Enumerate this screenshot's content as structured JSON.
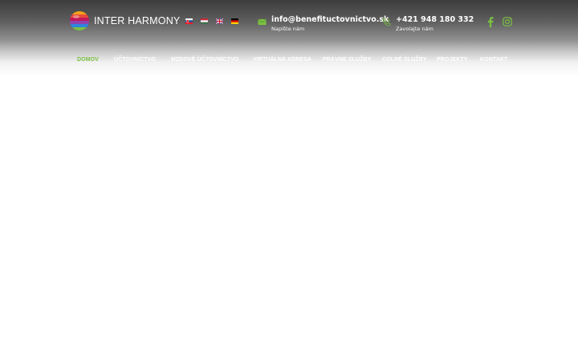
{
  "brand": {
    "name": "INTER HARMONY",
    "logo_icon": "striped-sphere-logo"
  },
  "languages": [
    {
      "code": "sk",
      "icon": "slovak-flag"
    },
    {
      "code": "hu",
      "icon": "hungarian-flag"
    },
    {
      "code": "en",
      "icon": "uk-flag"
    },
    {
      "code": "de",
      "icon": "german-flag"
    }
  ],
  "contact": {
    "email": {
      "value": "info@benefituctovnictvo.sk",
      "caption": "Napíšte nám",
      "icon": "envelope-icon"
    },
    "phone": {
      "value": "+421 948 180 332",
      "caption": "Zavolajte nám",
      "icon": "phone-icon"
    }
  },
  "social": [
    {
      "name": "facebook",
      "icon": "facebook-icon"
    },
    {
      "name": "instagram",
      "icon": "instagram-icon"
    }
  ],
  "nav": {
    "items": [
      {
        "label": "DOMOV",
        "active": true
      },
      {
        "label": "ÚČTOVNÍCTVO",
        "active": false
      },
      {
        "label": "MZDOVÉ ÚČTOVNÍCTVO",
        "active": false
      },
      {
        "label": "VIRTUÁLNA ADRESA",
        "active": false
      },
      {
        "label": "PRÁVNE SLUŽBY",
        "active": false
      },
      {
        "label": "COLNÉ SLUŽBY",
        "active": false
      },
      {
        "label": "PROJEKTY",
        "active": false
      },
      {
        "label": "KONTAKT",
        "active": false
      }
    ]
  },
  "colors": {
    "accent": "#7bc043",
    "header_top": "#3c3c3c",
    "text_light": "#ffffff"
  }
}
